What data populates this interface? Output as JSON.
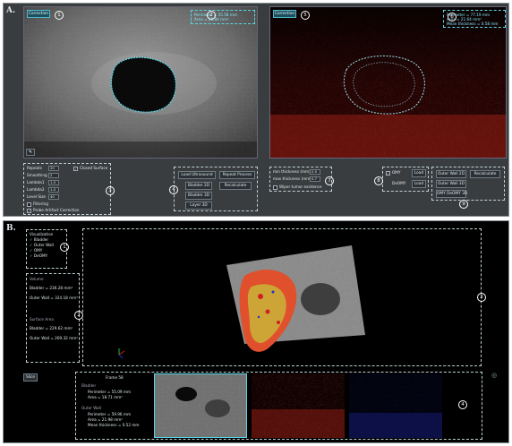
{
  "panelA": {
    "label": "A.",
    "left_view": {
      "correction_button": "Correction",
      "readout": [
        "Perimeter = 55.58 mm",
        "Area = 28.84 mm²"
      ]
    },
    "right_view": {
      "correction_button": "Correction",
      "readout": [
        "Perimeter = 77.19 mm",
        "Area = 21.64 mm²",
        "Mean thickness = 0.58 mm"
      ]
    },
    "params": [
      {
        "label": "Repeats",
        "value": "20"
      },
      {
        "label": "Smoothing",
        "value": "2"
      },
      {
        "label": "Lambda1",
        "value": "1.0"
      },
      {
        "label": "Lambda2",
        "value": "1.0"
      },
      {
        "label": "Level Size",
        "value": "40"
      }
    ],
    "closed_surface": "Closed Surface",
    "filtering": "Filtering",
    "probe_artifact": "Probe Artifact Correction",
    "load_buttons": [
      "Load Ultrasound",
      "Repeat Process",
      "Bladder 2D",
      "Recalculate",
      "Bladder 3D",
      "Layer 3D"
    ],
    "thickness": {
      "min_label": "min thickness (mm)",
      "min_value": "0.5",
      "max_label": "max thickness (mm)",
      "max_value": "0.7",
      "wiper": "Wiper tumor existence"
    },
    "modes": [
      {
        "label": "OMY",
        "btn": "Load"
      },
      {
        "label": "DeOMY",
        "btn": "Load"
      }
    ],
    "wall_buttons": [
      "Outer Wall 2D",
      "Recalculate",
      "Outer Wall 3D",
      "OMY DeOMY 3D"
    ],
    "numbers": [
      "1",
      "2",
      "3",
      "4",
      "5",
      "6",
      "7",
      "8",
      "9"
    ]
  },
  "panelB": {
    "label": "B.",
    "legend": {
      "title": "Visualization",
      "items": [
        {
          "label": "Bladder",
          "color": "#d8d03a"
        },
        {
          "label": "Outer Wall",
          "color": "#e0502c"
        },
        {
          "label": "OMY",
          "color": "#d02020"
        },
        {
          "label": "DeOMY",
          "color": "#2430c8"
        }
      ]
    },
    "volume": {
      "title": "Volume",
      "bladder": "Bladder = 236.28 mm³",
      "outer_wall": "Outer Wall = 324.18 mm³"
    },
    "surface": {
      "title": "Surface Area",
      "bladder": "Bladder = 229.62 mm²",
      "outer_wall": "Outer Wall = 269.32 mm²"
    },
    "slice_button": "Slice",
    "frame": {
      "title": "Frame 58",
      "bladder_title": "Bladder",
      "bladder_lines": [
        "Perimeter = 55.09 mm",
        "Area = 18.71 mm²"
      ],
      "wall_title": "Outer Wall",
      "wall_lines": [
        "Perimeter = 59.96 mm",
        "Area = 21.98 mm²",
        "Mean thickness = 0.52 mm"
      ]
    },
    "numbers": [
      "1",
      "2",
      "3",
      "4"
    ]
  }
}
